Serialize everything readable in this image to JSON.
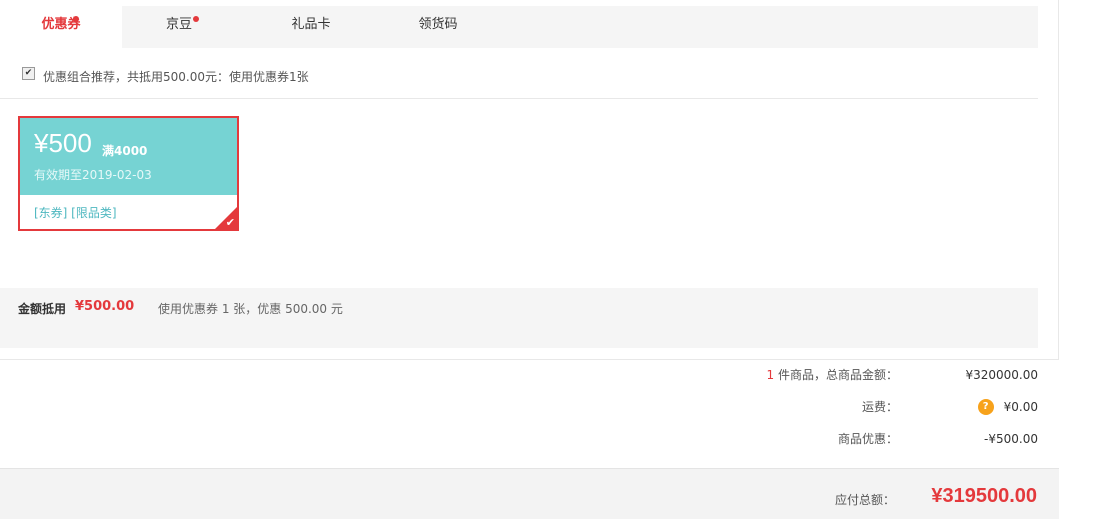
{
  "tabs": [
    {
      "label": "优惠券",
      "active": true,
      "dot": true
    },
    {
      "label": "京豆",
      "active": false,
      "dot": true
    },
    {
      "label": "礼品卡",
      "active": false,
      "dot": false
    },
    {
      "label": "领货码",
      "active": false,
      "dot": false
    }
  ],
  "combo": {
    "checked": true,
    "text": "优惠组合推荐，共抵用500.00元：使用优惠券1张"
  },
  "coupon": {
    "amount": "¥500",
    "condition": "满4000",
    "validity": "有效期至2019-02-03",
    "tags": "[东券] [限品类]",
    "selected": true
  },
  "summary": {
    "label": "金额抵用",
    "amount": "¥500.00",
    "desc": "使用优惠券 1 张，优惠 500.00 元"
  },
  "order": {
    "items_count": "1",
    "items_label": "件商品，总商品金额：",
    "items_total": "¥320000.00",
    "shipping_label": "运费：",
    "shipping_help": "?",
    "shipping_value": "¥0.00",
    "discount_label": "商品优惠：",
    "discount_value": "-¥500.00"
  },
  "total": {
    "label": "应付总额：",
    "amount": "¥319500.00"
  },
  "colors": {
    "accent": "#e4393c",
    "coupon": "#76d3d3",
    "help": "#f7a21b"
  }
}
